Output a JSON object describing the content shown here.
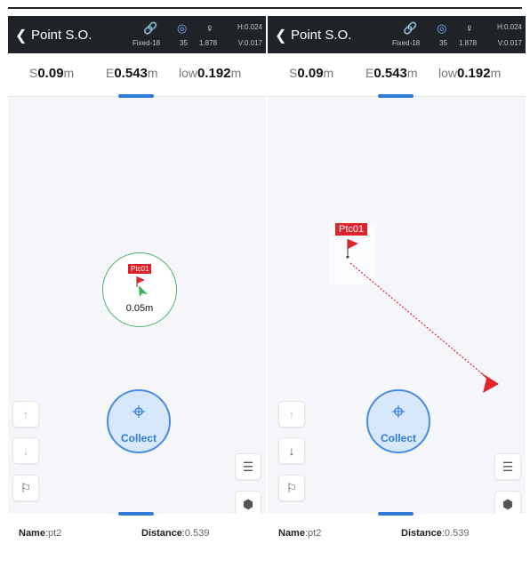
{
  "panels": [
    {
      "header": {
        "title": "Point S.O.",
        "fix": "Fixed-18",
        "sats": "35",
        "height": "1.878",
        "h": "H:0.024",
        "v": "V:0.017"
      },
      "coords": {
        "s_prefix": "S",
        "s_value": "0.09",
        "s_unit": "m",
        "e_prefix": "E",
        "e_value": "0.543",
        "e_unit": "m",
        "low_prefix": "low",
        "low_value": "0.192",
        "low_unit": "m"
      },
      "map": {
        "point_label": "Ptc01",
        "distance_label": "0.05m"
      },
      "collect_label": "Collect",
      "footer": {
        "name_key": "Name",
        "name_value": ":pt2",
        "distance_key": "Distance",
        "distance_value": ":0.539"
      }
    },
    {
      "header": {
        "title": "Point S.O.",
        "fix": "Fixed-18",
        "sats": "35",
        "height": "1.878",
        "h": "H:0.024",
        "v": "V:0.017"
      },
      "coords": {
        "s_prefix": "S",
        "s_value": "0.09",
        "s_unit": "m",
        "e_prefix": "E",
        "e_value": "0.543",
        "e_unit": "m",
        "low_prefix": "low",
        "low_value": "0.192",
        "low_unit": "m"
      },
      "map": {
        "point_label": "Ptc01"
      },
      "collect_label": "Collect",
      "footer": {
        "name_key": "Name",
        "name_value": ":pt2",
        "distance_key": "Distance",
        "distance_value": ":0.539"
      }
    }
  ],
  "icons": {
    "back": "chevron-left-icon",
    "satellite": "satellite-icon",
    "signal": "antenna-icon",
    "pole": "pole-icon",
    "up": "arrow-up-circle-icon",
    "down": "arrow-down-circle-icon",
    "flag": "flag-plus-icon",
    "settings": "sliders-icon",
    "view": "cube-view-icon",
    "target": "crosshair-icon"
  },
  "colors": {
    "accent": "#2f7bd6",
    "flag_red": "#e0232b",
    "circle_green": "#4fb36a",
    "status_bar": "#1f2328"
  }
}
